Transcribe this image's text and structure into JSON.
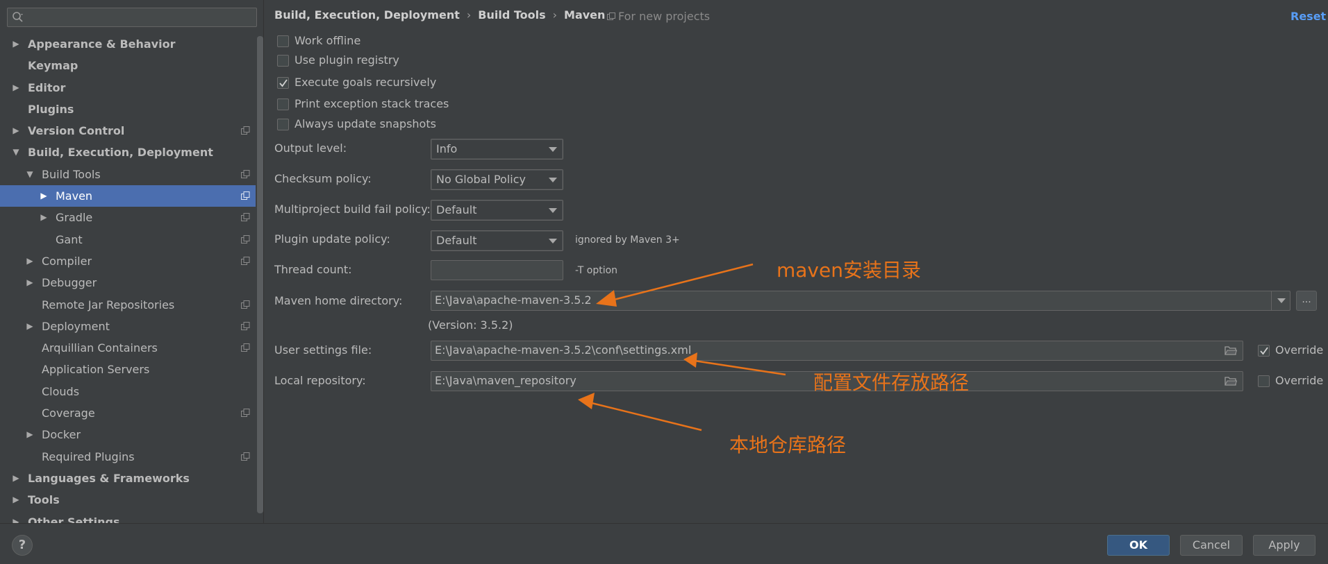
{
  "search": {
    "value": "",
    "placeholder": ""
  },
  "sidebar": {
    "items": [
      {
        "label": "Appearance & Behavior",
        "level": 0,
        "arrow": "right",
        "bold": true,
        "project_icon": false,
        "selected": false
      },
      {
        "label": "Keymap",
        "level": 0,
        "arrow": "none",
        "bold": true,
        "project_icon": false,
        "selected": false
      },
      {
        "label": "Editor",
        "level": 0,
        "arrow": "right",
        "bold": true,
        "project_icon": false,
        "selected": false
      },
      {
        "label": "Plugins",
        "level": 0,
        "arrow": "none",
        "bold": true,
        "project_icon": false,
        "selected": false
      },
      {
        "label": "Version Control",
        "level": 0,
        "arrow": "right",
        "bold": true,
        "project_icon": true,
        "selected": false
      },
      {
        "label": "Build, Execution, Deployment",
        "level": 0,
        "arrow": "down",
        "bold": true,
        "project_icon": false,
        "selected": false
      },
      {
        "label": "Build Tools",
        "level": 1,
        "arrow": "down",
        "bold": false,
        "project_icon": true,
        "selected": false
      },
      {
        "label": "Maven",
        "level": 2,
        "arrow": "right",
        "bold": false,
        "project_icon": true,
        "selected": true
      },
      {
        "label": "Gradle",
        "level": 2,
        "arrow": "right",
        "bold": false,
        "project_icon": true,
        "selected": false
      },
      {
        "label": "Gant",
        "level": 2,
        "arrow": "none",
        "bold": false,
        "project_icon": true,
        "selected": false
      },
      {
        "label": "Compiler",
        "level": 1,
        "arrow": "right",
        "bold": false,
        "project_icon": true,
        "selected": false
      },
      {
        "label": "Debugger",
        "level": 1,
        "arrow": "right",
        "bold": false,
        "project_icon": false,
        "selected": false
      },
      {
        "label": "Remote Jar Repositories",
        "level": 1,
        "arrow": "none",
        "bold": false,
        "project_icon": true,
        "selected": false
      },
      {
        "label": "Deployment",
        "level": 1,
        "arrow": "right",
        "bold": false,
        "project_icon": true,
        "selected": false
      },
      {
        "label": "Arquillian Containers",
        "level": 1,
        "arrow": "none",
        "bold": false,
        "project_icon": true,
        "selected": false
      },
      {
        "label": "Application Servers",
        "level": 1,
        "arrow": "none",
        "bold": false,
        "project_icon": false,
        "selected": false
      },
      {
        "label": "Clouds",
        "level": 1,
        "arrow": "none",
        "bold": false,
        "project_icon": false,
        "selected": false
      },
      {
        "label": "Coverage",
        "level": 1,
        "arrow": "none",
        "bold": false,
        "project_icon": true,
        "selected": false
      },
      {
        "label": "Docker",
        "level": 1,
        "arrow": "right",
        "bold": false,
        "project_icon": false,
        "selected": false
      },
      {
        "label": "Required Plugins",
        "level": 1,
        "arrow": "none",
        "bold": false,
        "project_icon": true,
        "selected": false
      },
      {
        "label": "Languages & Frameworks",
        "level": 0,
        "arrow": "right",
        "bold": true,
        "project_icon": false,
        "selected": false
      },
      {
        "label": "Tools",
        "level": 0,
        "arrow": "right",
        "bold": true,
        "project_icon": false,
        "selected": false
      },
      {
        "label": "Other Settings",
        "level": 0,
        "arrow": "right",
        "bold": true,
        "project_icon": false,
        "selected": false
      }
    ]
  },
  "header": {
    "breadcrumb": [
      "Build, Execution, Deployment",
      "Build Tools",
      "Maven"
    ],
    "for_new_projects": "For new projects",
    "reset_label": "Reset"
  },
  "checkboxes": [
    {
      "label": "Work offline",
      "checked": false
    },
    {
      "label": "Use plugin registry",
      "checked": false
    },
    {
      "label": "Execute goals recursively",
      "checked": true
    },
    {
      "label": "Print exception stack traces",
      "checked": false
    },
    {
      "label": "Always update snapshots",
      "checked": false
    }
  ],
  "form": {
    "output_level_label": "Output level:",
    "output_level_value": "Info",
    "checksum_policy_label": "Checksum policy:",
    "checksum_policy_value": "No Global Policy",
    "multiproject_label": "Multiproject build fail policy:",
    "multiproject_value": "Default",
    "plugin_update_label": "Plugin update policy:",
    "plugin_update_value": "Default",
    "plugin_update_hint": "ignored by Maven 3+",
    "thread_count_label": "Thread count:",
    "thread_count_value": "",
    "thread_count_hint": "-T option",
    "maven_home_label": "Maven home directory:",
    "maven_home_value": "E:\\Java\\apache-maven-3.5.2",
    "maven_home_browse": "...",
    "version_text": "(Version: 3.5.2)",
    "user_settings_label": "User settings file:",
    "user_settings_value": "E:\\Java\\apache-maven-3.5.2\\conf\\settings.xml",
    "user_settings_override_label": "Override",
    "user_settings_override_checked": true,
    "local_repo_label": "Local repository:",
    "local_repo_value": "E:\\Java\\maven_repository",
    "local_repo_override_label": "Override",
    "local_repo_override_checked": false
  },
  "annotations": {
    "maven_home_note": "maven安装目录",
    "settings_note": "配置文件存放路径",
    "local_repo_note": "本地仓库路径",
    "color": "#e8731a"
  },
  "footer": {
    "help_label": "?",
    "ok_label": "OK",
    "cancel_label": "Cancel",
    "apply_label": "Apply"
  },
  "colors": {
    "background": "#3c3f41",
    "selection": "#4b6eaf",
    "link": "#589df6",
    "primary_button": "#365880"
  }
}
